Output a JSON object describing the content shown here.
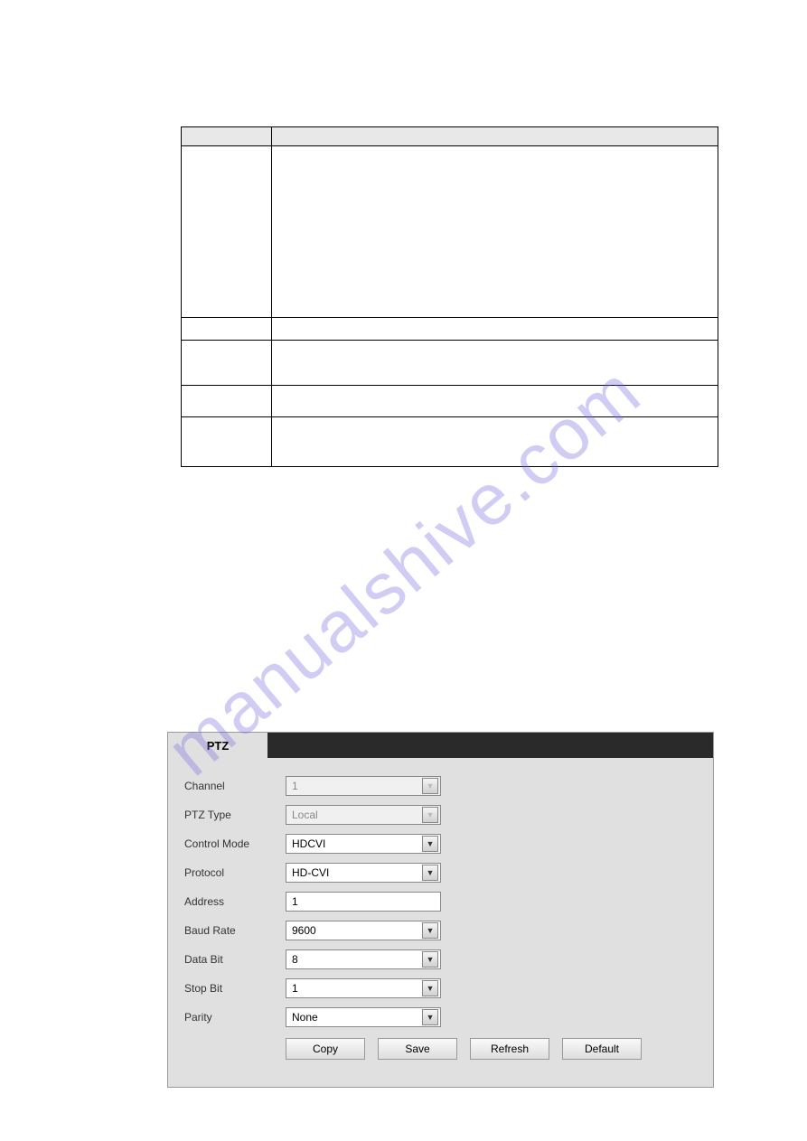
{
  "watermark": "manualshive.com",
  "paramTable": {
    "headers": [
      "",
      ""
    ],
    "rows": [
      {
        "label": "",
        "value": ""
      },
      {
        "label": "",
        "value": ""
      },
      {
        "label": "",
        "value": ""
      },
      {
        "label": "",
        "value": ""
      },
      {
        "label": "",
        "value": ""
      }
    ]
  },
  "ptz": {
    "tabLabel": "PTZ",
    "fields": {
      "channel": {
        "label": "Channel",
        "value": "1"
      },
      "ptzType": {
        "label": "PTZ Type",
        "value": "Local"
      },
      "controlMode": {
        "label": "Control Mode",
        "value": "HDCVI"
      },
      "protocol": {
        "label": "Protocol",
        "value": "HD-CVI"
      },
      "address": {
        "label": "Address",
        "value": "1"
      },
      "baudRate": {
        "label": "Baud Rate",
        "value": "9600"
      },
      "dataBit": {
        "label": "Data Bit",
        "value": "8"
      },
      "stopBit": {
        "label": "Stop Bit",
        "value": "1"
      },
      "parity": {
        "label": "Parity",
        "value": "None"
      }
    },
    "buttons": {
      "copy": "Copy",
      "save": "Save",
      "refresh": "Refresh",
      "default": "Default"
    }
  }
}
